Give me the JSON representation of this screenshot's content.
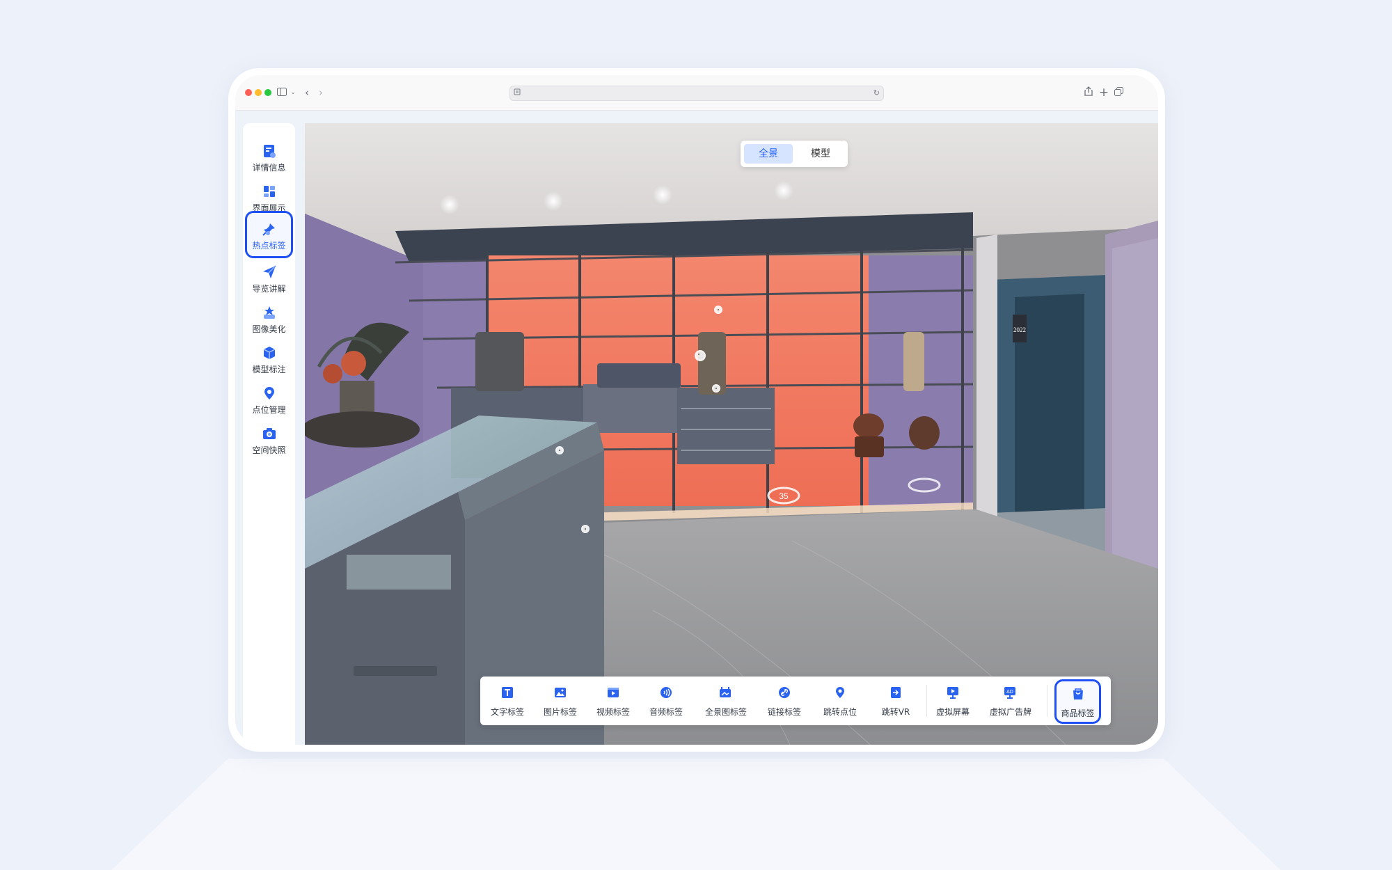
{
  "sidebar": {
    "items": [
      {
        "label": "详情信息",
        "icon": "document-icon"
      },
      {
        "label": "界面展示",
        "icon": "layout-icon"
      },
      {
        "label": "热点标签",
        "icon": "pin-icon",
        "active": true
      },
      {
        "label": "导览讲解",
        "icon": "paper-plane-icon"
      },
      {
        "label": "图像美化",
        "icon": "image-enhance-icon"
      },
      {
        "label": "模型标注",
        "icon": "cube-icon"
      },
      {
        "label": "点位管理",
        "icon": "location-icon"
      },
      {
        "label": "空间快照",
        "icon": "camera-icon"
      }
    ]
  },
  "view_toggle": {
    "panorama": "全景",
    "model": "模型"
  },
  "tag_toolbar": {
    "items": [
      {
        "label": "文字标签",
        "icon": "text-icon"
      },
      {
        "label": "图片标签",
        "icon": "image-icon"
      },
      {
        "label": "视频标签",
        "icon": "video-icon"
      },
      {
        "label": "音频标签",
        "icon": "audio-icon"
      },
      {
        "label": "全景图标签",
        "icon": "panorama-icon"
      },
      {
        "label": "链接标签",
        "icon": "link-icon"
      },
      {
        "label": "跳转点位",
        "icon": "location-pin-icon"
      },
      {
        "label": "跳转VR",
        "icon": "vr-jump-icon"
      },
      {
        "label": "虚拟屏幕",
        "icon": "screen-icon"
      },
      {
        "label": "虚拟广告牌",
        "icon": "ad-board-icon"
      },
      {
        "label": "商品标签",
        "icon": "shopping-bag-icon",
        "active": true
      }
    ]
  },
  "scene": {
    "floor_markers": [
      "35"
    ],
    "wall_sign": "2022"
  },
  "colors": {
    "accent": "#2a63f0",
    "highlight_border": "#1d4ff5",
    "page_bg": "#edf1f9"
  }
}
